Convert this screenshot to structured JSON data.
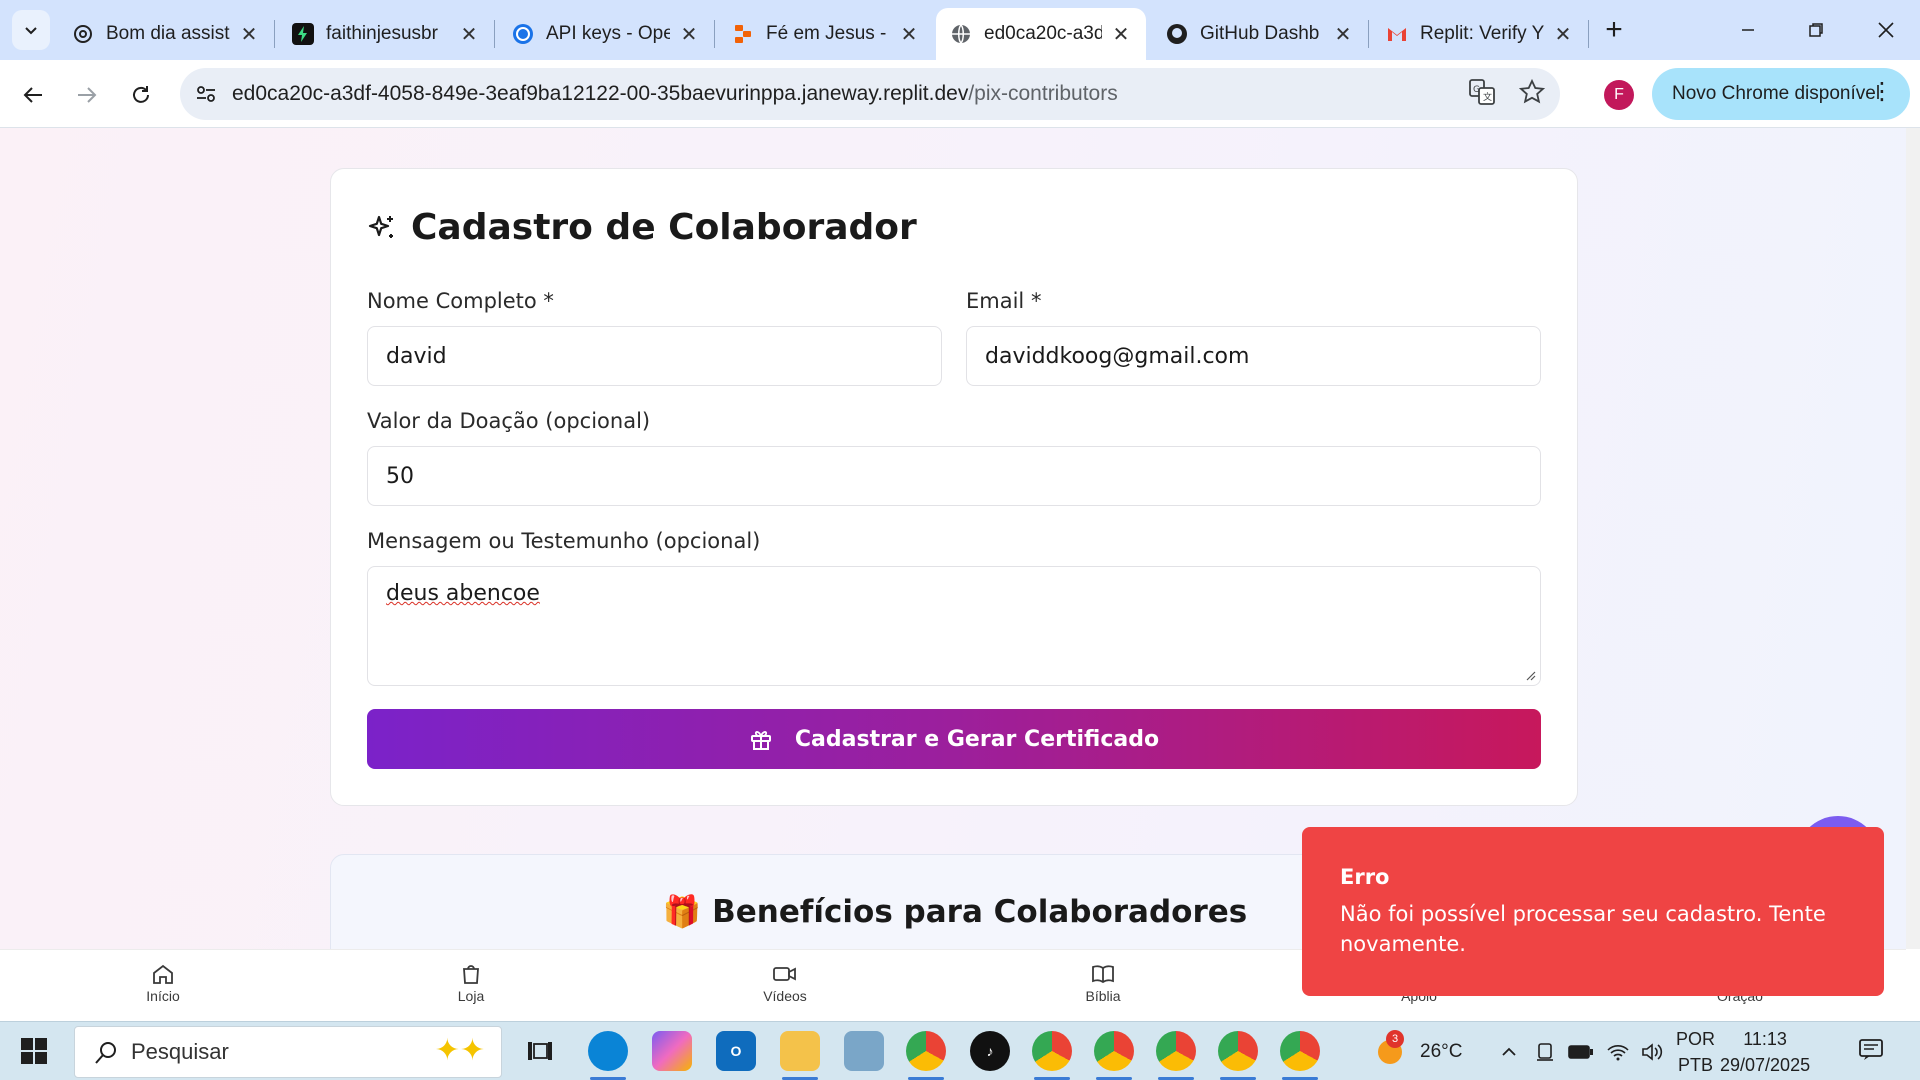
{
  "browser": {
    "tabs": [
      {
        "title": "Bom dia assist",
        "icon": "openai-icon"
      },
      {
        "title": "faithinjesusbr",
        "icon": "bolt-icon"
      },
      {
        "title": "API keys - Ope",
        "icon": "openai-icon"
      },
      {
        "title": "Fé em Jesus -",
        "icon": "replit-icon"
      },
      {
        "title": "ed0ca20c-a3d",
        "icon": "globe-icon",
        "active": true
      },
      {
        "title": "GitHub Dashb",
        "icon": "github-icon"
      },
      {
        "title": "Replit: Verify Y",
        "icon": "gmail-icon"
      }
    ],
    "url_host": "ed0ca20c-a3df-4058-849e-3eaf9ba12122-00-35baevurinppa.janeway.replit.dev",
    "url_path": "/pix-contributors",
    "profile_initial": "F",
    "update_label": "Novo Chrome disponível"
  },
  "form": {
    "title": "Cadastro de Colaborador",
    "name_label": "Nome Completo *",
    "name_value": "david",
    "email_label": "Email *",
    "email_value": "daviddkoog@gmail.com",
    "donation_label": "Valor da Doação (opcional)",
    "donation_value": "50",
    "message_label": "Mensagem ou Testemunho (opcional)",
    "message_value": "deus abencoe",
    "submit_label": "Cadastrar e Gerar Certificado"
  },
  "benefits": {
    "title": "🎁 Benefícios para Colaboradores"
  },
  "bottom_nav": [
    {
      "label": "Início",
      "icon": "home-icon"
    },
    {
      "label": "Loja",
      "icon": "bag-icon"
    },
    {
      "label": "Vídeos",
      "icon": "video-icon"
    },
    {
      "label": "Bíblia",
      "icon": "book-icon"
    },
    {
      "label": "Apoio",
      "icon": "heart-icon"
    },
    {
      "label": "Oração",
      "icon": "pray-icon"
    }
  ],
  "toast": {
    "title": "Erro",
    "message": "Não foi possível processar seu cadastro. Tente novamente."
  },
  "taskbar": {
    "search_placeholder": "Pesquisar",
    "weather": "26°C",
    "weather_badge": "3",
    "lang_1": "POR",
    "lang_2": "PTB",
    "time": "11:13",
    "date": "29/07/2025"
  },
  "colors": {
    "accent_start": "#7b22c9",
    "accent_end": "#c7185c",
    "error": "#ef4444",
    "tab_strip": "#d3e3fd"
  }
}
